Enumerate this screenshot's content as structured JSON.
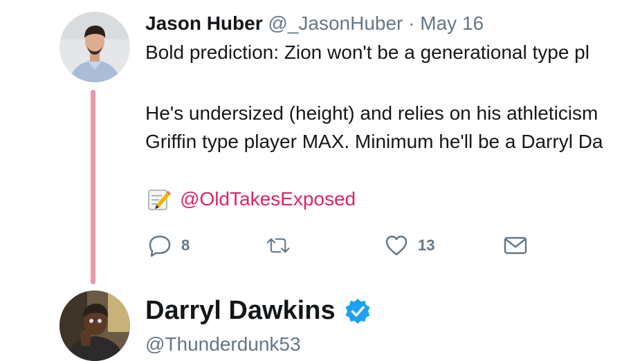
{
  "tweet": {
    "author_name": "Jason Huber",
    "author_handle": "@_JasonHuber",
    "separator": "·",
    "date": "May 16",
    "lines": [
      "Bold prediction: Zion won't be a generational type pl",
      "He's undersized (height) and relies on his athleticism",
      "Griffin type player MAX. Minimum he'll be a Darryl Da"
    ],
    "credit_icon": "memo-emoji",
    "credit_mention": "@OldTakesExposed",
    "actions": {
      "reply_icon": "reply-icon",
      "reply_count": "8",
      "retweet_icon": "retweet-icon",
      "like_icon": "heart-icon",
      "like_count": "13",
      "dm_icon": "envelope-icon"
    },
    "thread_color": "#ec97ad",
    "mention_color": "#e0245e"
  },
  "reply": {
    "author_name": "Darryl Dawkins",
    "verified_icon": "verified-badge-icon",
    "verified_color": "#1da1f2",
    "author_handle": "@Thunderdunk53"
  }
}
